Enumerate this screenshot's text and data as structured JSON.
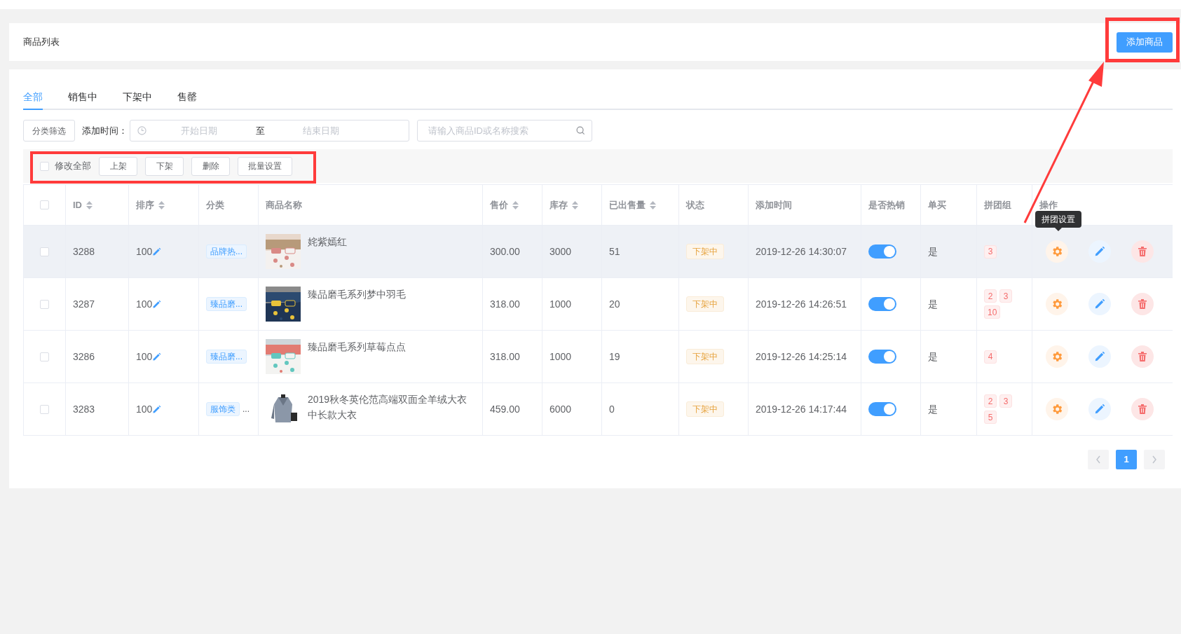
{
  "header": {
    "title": "商品列表",
    "add_button": "添加商品"
  },
  "tabs": [
    {
      "label": "全部",
      "selected": true
    },
    {
      "label": "销售中",
      "selected": false
    },
    {
      "label": "下架中",
      "selected": false
    },
    {
      "label": "售罄",
      "selected": false
    }
  ],
  "filters": {
    "category_button": "分类筛选",
    "time_label": "添加时间：",
    "start_placeholder": "开始日期",
    "separator": "至",
    "end_placeholder": "结束日期",
    "search_placeholder": "请输入商品ID或名称搜索"
  },
  "batch": {
    "select_all": {
      "label": "修改全部",
      "checked": false
    },
    "buttons": [
      "上架",
      "下架",
      "删除",
      "批量设置"
    ]
  },
  "table": {
    "select_all_checked": false,
    "columns": [
      {
        "label": "ID",
        "sortable": true
      },
      {
        "label": "排序",
        "sortable": true
      },
      {
        "label": "分类",
        "sortable": false
      },
      {
        "label": "商品名称",
        "sortable": false
      },
      {
        "label": "售价",
        "sortable": true
      },
      {
        "label": "库存",
        "sortable": true
      },
      {
        "label": "已出售量",
        "sortable": true
      },
      {
        "label": "状态",
        "sortable": false
      },
      {
        "label": "添加时间",
        "sortable": false
      },
      {
        "label": "是否热销",
        "sortable": false
      },
      {
        "label": "单买",
        "sortable": false
      },
      {
        "label": "拼团组",
        "sortable": false
      },
      {
        "label": "操作",
        "sortable": false
      }
    ],
    "rows": [
      {
        "checked": false,
        "hovered": true,
        "id": "3288",
        "sort": "100",
        "category": "品牌热...",
        "name": "姹紫嫣红",
        "price": "300.00",
        "stock": "3000",
        "sold": "51",
        "status": "下架中",
        "added": "2019-12-26 14:30:07",
        "hot": true,
        "single": "是",
        "groups": [
          "3"
        ],
        "action_tooltip": "拼团设置"
      },
      {
        "checked": false,
        "hovered": false,
        "id": "3287",
        "sort": "100",
        "category": "臻品磨...",
        "name": "臻品磨毛系列梦中羽毛",
        "price": "318.00",
        "stock": "1000",
        "sold": "20",
        "status": "下架中",
        "added": "2019-12-26 14:26:51",
        "hot": true,
        "single": "是",
        "groups": [
          "2",
          "3",
          "10"
        ]
      },
      {
        "checked": false,
        "hovered": false,
        "id": "3286",
        "sort": "100",
        "category": "臻品磨...",
        "name": "臻品磨毛系列草莓点点",
        "price": "318.00",
        "stock": "1000",
        "sold": "19",
        "status": "下架中",
        "added": "2019-12-26 14:25:14",
        "hot": true,
        "single": "是",
        "groups": [
          "4"
        ]
      },
      {
        "checked": false,
        "hovered": false,
        "id": "3283",
        "sort": "100",
        "category": "服饰类",
        "category_overflow": "...",
        "name": "2019秋冬英伦范高端双面全羊绒大衣中长款大衣",
        "price": "459.00",
        "stock": "6000",
        "sold": "0",
        "status": "下架中",
        "added": "2019-12-26 14:17:44",
        "hot": true,
        "single": "是",
        "groups": [
          "2",
          "3",
          "5"
        ]
      }
    ]
  },
  "pagination": {
    "pages": [
      {
        "label": "1",
        "selected": true
      }
    ]
  }
}
